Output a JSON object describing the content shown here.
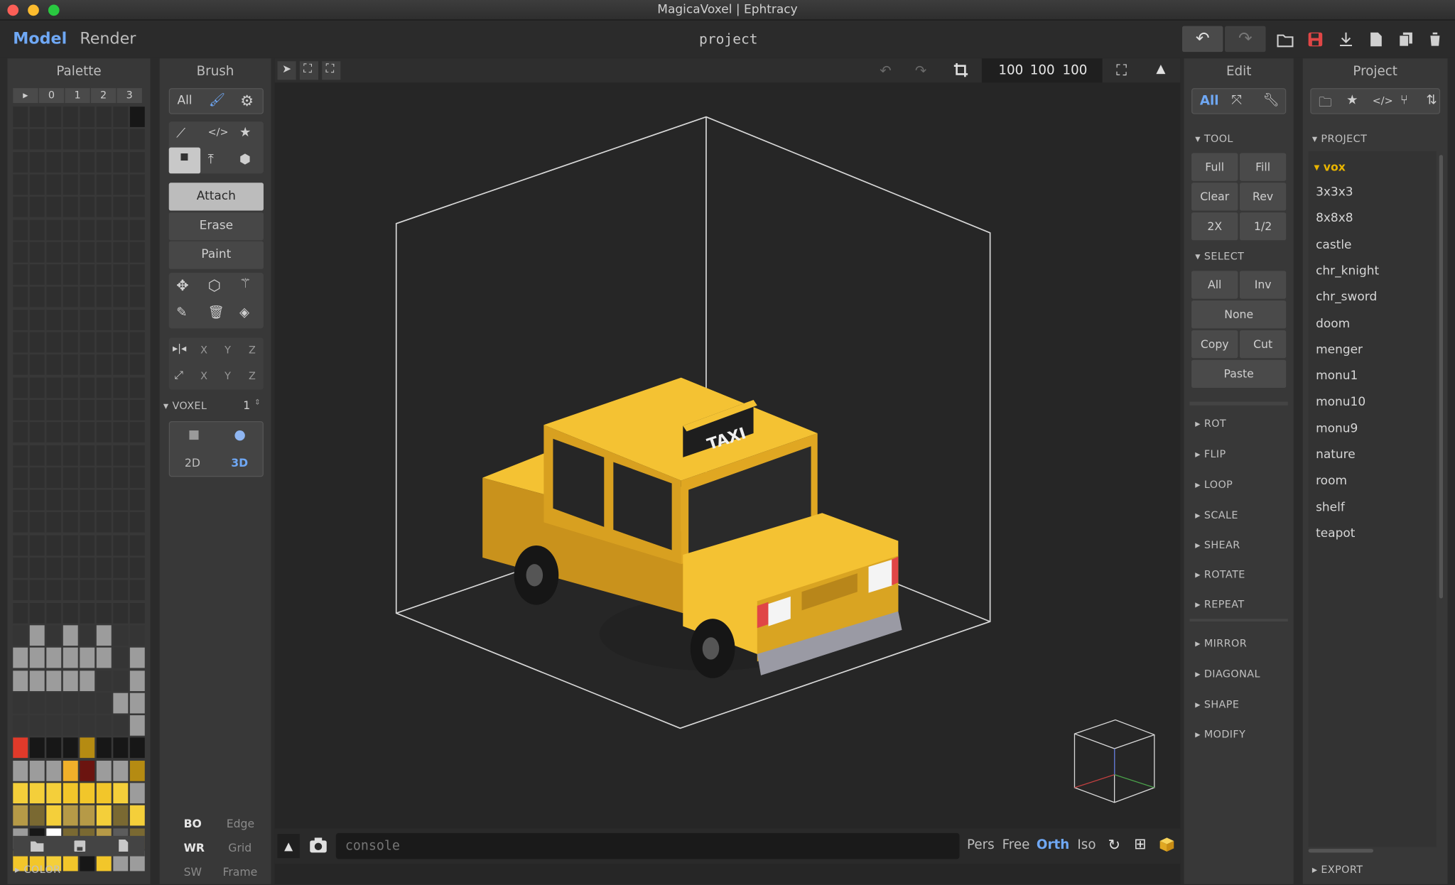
{
  "window": {
    "title": "MagicaVoxel | Ephtracy",
    "project_name": "project"
  },
  "modes": {
    "model": "Model",
    "render": "Render"
  },
  "palette": {
    "title": "Palette",
    "tabs": [
      "▸",
      "0",
      "1",
      "2",
      "3"
    ],
    "footer": "COLOR",
    "colors": [
      "#2f2f2f",
      "#353535",
      "#e03a2a",
      "#b58b12",
      "#6b1410",
      "#f2c62a",
      "#f0b02a",
      "#f4cf3a",
      "#b69a47",
      "#7a6932",
      "#f3f3f3",
      "#9c9c9c",
      "#171717",
      "#ffffff",
      "#5c5c5c"
    ]
  },
  "brush": {
    "title": "Brush",
    "all": "All",
    "attach": "Attach",
    "erase": "Erase",
    "paint": "Paint",
    "voxel_label": "VOXEL",
    "voxel_value": "1",
    "mode_2d": "2D",
    "mode_3d": "3D",
    "x": "X",
    "y": "Y",
    "z": "Z",
    "bottom": {
      "bo": "BO",
      "edge": "Edge",
      "wr": "WR",
      "grid": "Grid",
      "sw": "SW",
      "frame": "Frame"
    }
  },
  "viewport": {
    "size_x": "100",
    "size_y": "100",
    "size_z": "100",
    "taxi_sign": "TAXI",
    "console": "console",
    "views": {
      "pers": "Pers",
      "free": "Free",
      "orth": "Orth",
      "iso": "Iso"
    }
  },
  "edit": {
    "title": "Edit",
    "all": "All",
    "tool": "TOOL",
    "full": "Full",
    "fill": "Fill",
    "clear": "Clear",
    "rev": "Rev",
    "x2": "2X",
    "half": "1/2",
    "select": "SELECT",
    "sel_all": "All",
    "inv": "Inv",
    "none": "None",
    "copy": "Copy",
    "cut": "Cut",
    "paste": "Paste",
    "sections": [
      "ROT",
      "FLIP",
      "LOOP",
      "SCALE",
      "SHEAR",
      "ROTATE",
      "REPEAT",
      "MIRROR",
      "DIAGONAL",
      "SHAPE",
      "MODIFY"
    ]
  },
  "project": {
    "title": "Project",
    "section": "PROJECT",
    "folder": "vox",
    "items": [
      "3x3x3",
      "8x8x8",
      "castle",
      "chr_knight",
      "chr_sword",
      "doom",
      "menger",
      "monu1",
      "monu10",
      "monu9",
      "nature",
      "room",
      "shelf",
      "teapot"
    ],
    "export": "EXPORT"
  },
  "colors": {
    "accent": "#6fa8f5",
    "save_red": "#e04646",
    "taxi_yellow": "#f4b82a",
    "folder_yellow": "#e8b400"
  }
}
